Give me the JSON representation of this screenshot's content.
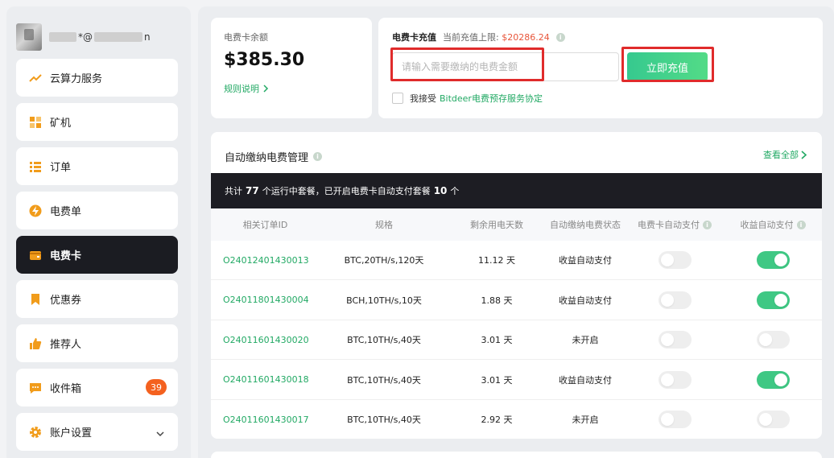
{
  "user": {
    "email_visible_part": "*@",
    "email_end": "n"
  },
  "sidebar": {
    "items": [
      {
        "label": "云算力服务",
        "icon": "trend-up-icon"
      },
      {
        "label": "矿机",
        "icon": "grid-icon"
      },
      {
        "label": "订单",
        "icon": "list-icon"
      },
      {
        "label": "电费单",
        "icon": "bolt-icon"
      },
      {
        "label": "电费卡",
        "icon": "wallet-icon",
        "active": true
      },
      {
        "label": "优惠券",
        "icon": "bookmark-icon"
      },
      {
        "label": "推荐人",
        "icon": "thumbs-up-icon"
      },
      {
        "label": "收件箱",
        "icon": "message-icon",
        "badge": "39"
      },
      {
        "label": "账户设置",
        "icon": "gear-icon"
      }
    ]
  },
  "balance": {
    "title": "电费卡余额",
    "amount": "$385.30",
    "rule_link": "规则说明"
  },
  "recharge": {
    "title": "电费卡充值",
    "limit_label": "当前充值上限:",
    "limit_value": "$20286.24",
    "input_placeholder": "请输入需要缴纳的电费金额",
    "button_label": "立即充值",
    "agree_prefix": "我接受",
    "agree_link": "Bitdeer电费预存服务协定"
  },
  "auto_pay": {
    "title": "自动缴纳电费管理",
    "view_all": "查看全部",
    "summary": {
      "p1": "共计",
      "running": "77",
      "p2": "个运行中套餐，已开启电费卡自动支付套餐",
      "enabled": "10",
      "p3": "个"
    },
    "columns": [
      "相关订单ID",
      "规格",
      "剩余用电天数",
      "自动缴纳电费状态",
      "电费卡自动支付",
      "收益自动支付"
    ],
    "rows": [
      {
        "order_id": "O24012401430013",
        "spec": "BTC,20TH/s,120天",
        "days": "11.12 天",
        "status": "收益自动支付",
        "card_auto": false,
        "income_auto": true
      },
      {
        "order_id": "O24011801430004",
        "spec": "BCH,10TH/s,10天",
        "days": "1.88 天",
        "status": "收益自动支付",
        "card_auto": false,
        "income_auto": true
      },
      {
        "order_id": "O24011601430020",
        "spec": "BTC,10TH/s,40天",
        "days": "3.01 天",
        "status": "未开启",
        "card_auto": false,
        "income_auto": false
      },
      {
        "order_id": "O24011601430018",
        "spec": "BTC,10TH/s,40天",
        "days": "3.01 天",
        "status": "收益自动支付",
        "card_auto": false,
        "income_auto": true
      },
      {
        "order_id": "O24011601430017",
        "spec": "BTC,10TH/s,40天",
        "days": "2.92 天",
        "status": "未开启",
        "card_auto": false,
        "income_auto": false
      }
    ]
  },
  "colors": {
    "accent_green": "#22a964",
    "toggle_on": "#3fc884",
    "highlight_red": "#e02b2b",
    "limit_red": "#e8553a",
    "badge_orange": "#f4611f"
  }
}
